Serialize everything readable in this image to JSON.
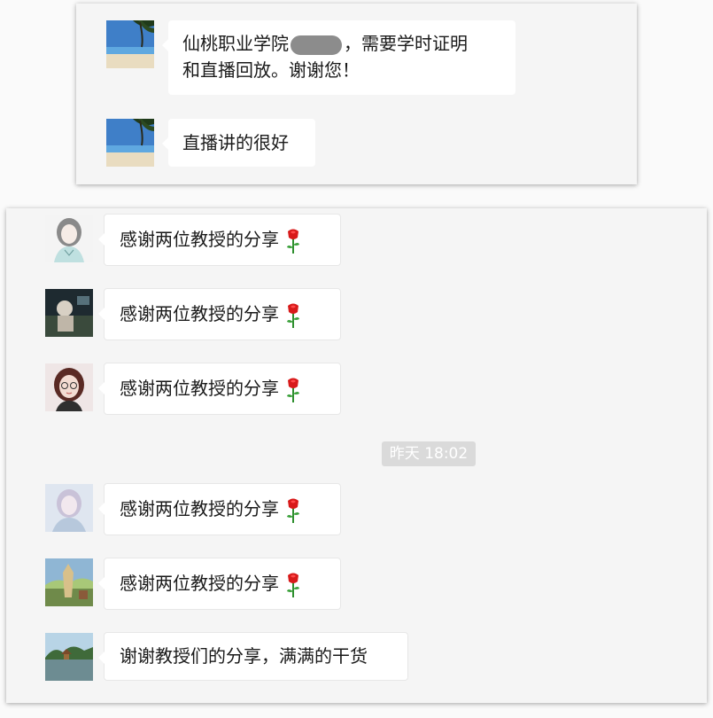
{
  "top_panel": {
    "messages": [
      {
        "avatar": "beach-avatar",
        "text_part1": "仙桃职业学院",
        "text_part2": "，需要学时证明",
        "text_line2": "和直播回放。谢谢您！"
      },
      {
        "avatar": "beach-avatar",
        "text": "直播讲的很好"
      }
    ]
  },
  "bottom_panel": {
    "messages": [
      {
        "avatar": "sketch-girl-avatar",
        "text": "感谢两位教授的分享",
        "icon": "rose-icon"
      },
      {
        "avatar": "dark-scene-avatar",
        "text": "感谢两位教授的分享",
        "icon": "rose-icon"
      },
      {
        "avatar": "glasses-girl-avatar",
        "text": "感谢两位教授的分享",
        "icon": "rose-icon"
      },
      {
        "avatar": "pale-portrait-avatar",
        "text": "感谢两位教授的分享",
        "icon": "rose-icon"
      },
      {
        "avatar": "fantasy-landscape-avatar",
        "text": "感谢两位教授的分享",
        "icon": "rose-icon"
      },
      {
        "avatar": "lake-pavilion-avatar",
        "text": "谢谢教授们的分享，满满的干货"
      }
    ],
    "timestamp": "昨天 18:02"
  }
}
